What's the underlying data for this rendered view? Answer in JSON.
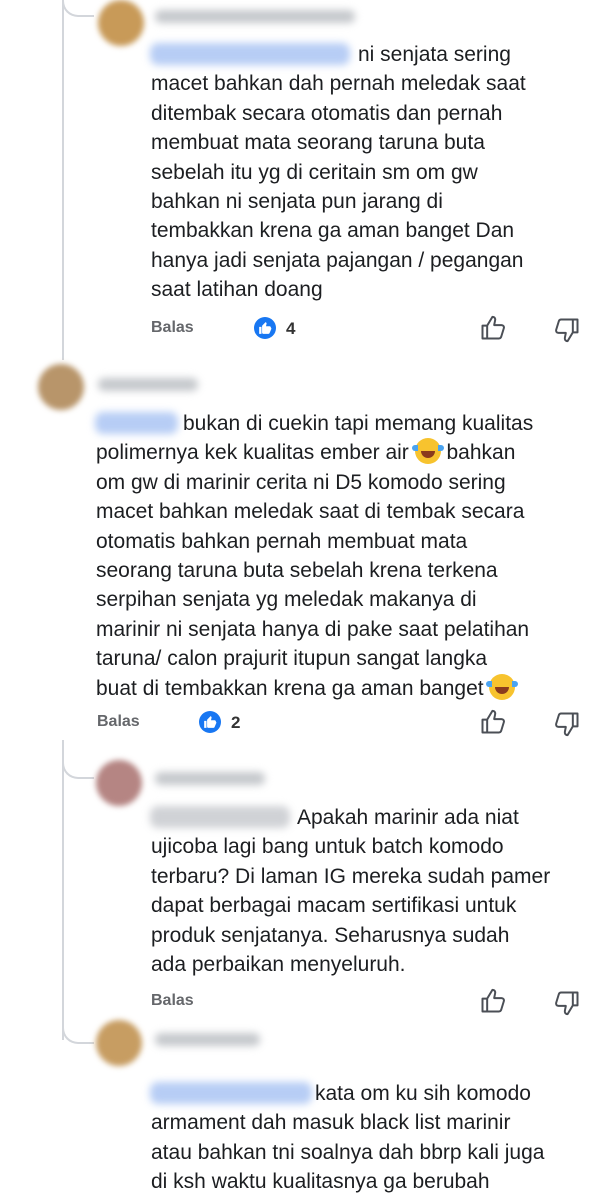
{
  "colors": {
    "like_badge": "#1877f2",
    "thread_line": "#d3d6db",
    "action_text": "#65676b"
  },
  "comments": [
    {
      "text": "ni senjata sering\nmacet bahkan dah pernah meledak saat\nditembak secara otomatis dan pernah\nmembuat mata seorang taruna buta\nsebelah itu yg di ceritain sm om gw\nbahkan ni senjata pun jarang di\ntembakkan krena ga aman banget Dan\nhanya jadi senjata pajangan / pegangan\nsaat latihan doang",
      "reply_label": "Balas",
      "like_count": "4",
      "icons": [
        "like-badge-icon",
        "thumbs-up-icon",
        "thumbs-down-icon"
      ]
    },
    {
      "text_part1": "bukan di cuekin tapi memang kualitas\npolimernya kek kualitas ember air ",
      "emoji_1": "😂",
      "text_part2": " bahkan\nom gw di marinir cerita ni D5 komodo sering\nmacet bahkan meledak saat di tembak secara\notomatis bahkan pernah membuat mata\nseorang taruna buta sebelah krena terkena\nserpihan senjata yg meledak makanya di\nmarinir ni senjata hanya di pake saat pelatihan\ntaruna/ calon prajurit itupun sangat langka\nbuat di tembakkan krena ga aman banget ",
      "emoji_2": "😂",
      "reply_label": "Balas",
      "like_count": "2",
      "icons": [
        "like-badge-icon",
        "thumbs-up-icon",
        "thumbs-down-icon"
      ]
    },
    {
      "text": "Apakah marinir ada niat\nujicoba lagi bang untuk batch komodo\nterbaru? Di laman IG mereka sudah pamer\ndapat berbagai macam sertifikasi untuk\nproduk senjatanya. Seharusnya sudah\nada perbaikan menyeluruh.",
      "reply_label": "Balas",
      "icons": [
        "thumbs-up-icon",
        "thumbs-down-icon"
      ]
    },
    {
      "text": "kata om ku sih komodo\narmament dah masuk black list marinir\natau bahkan tni soalnya dah bbrp kali juga\ndi ksh waktu kualitasnya ga berubah"
    }
  ]
}
